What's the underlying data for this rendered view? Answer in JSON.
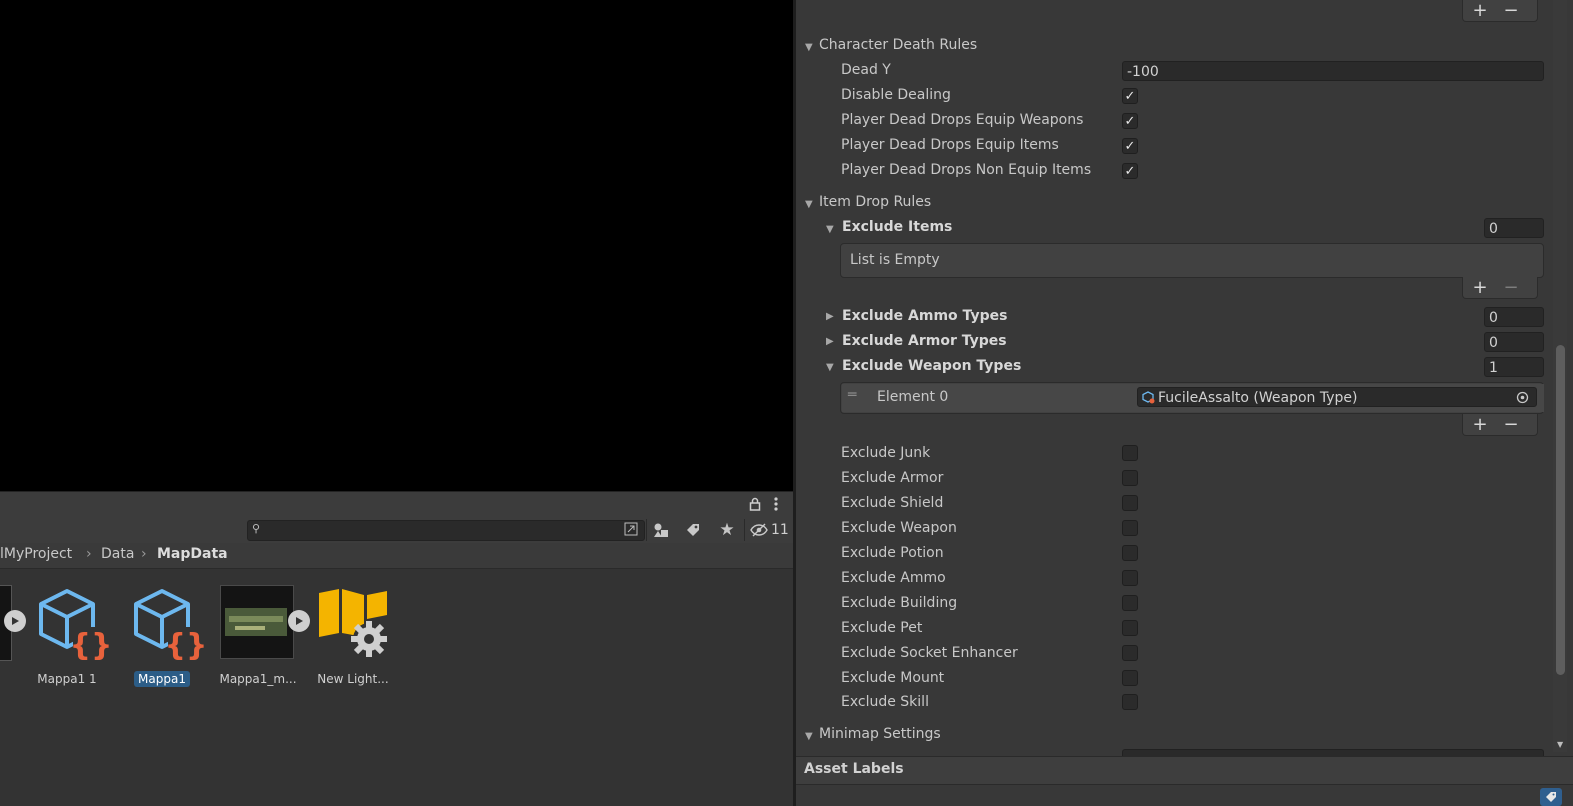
{
  "project": {
    "breadcrumb": [
      "lMyProject",
      "Data",
      "MapData"
    ],
    "hidden_count": "11",
    "assets": [
      {
        "label": "...",
        "icon": "video-asset-icon",
        "selected": false
      },
      {
        "label": "Mappa1 1",
        "icon": "scriptable-object-icon",
        "selected": false
      },
      {
        "label": "Mappa1",
        "icon": "scriptable-object-icon",
        "selected": true
      },
      {
        "label": "Mappa1_m...",
        "icon": "texture-thumbnail-icon",
        "selected": false
      },
      {
        "label": "New Light...",
        "icon": "lighting-settings-icon",
        "selected": false
      }
    ]
  },
  "inspector": {
    "character_death": {
      "title": "Character Death Rules",
      "dead_y_label": "Dead Y",
      "dead_y_value": "-100",
      "checks": [
        {
          "label": "Disable Dealing",
          "checked": true
        },
        {
          "label": "Player Dead Drops Equip Weapons",
          "checked": true
        },
        {
          "label": "Player Dead Drops Equip Items",
          "checked": true
        },
        {
          "label": "Player Dead Drops Non Equip Items",
          "checked": true
        }
      ]
    },
    "item_drop": {
      "title": "Item Drop Rules",
      "exclude_items": {
        "label": "Exclude Items",
        "count": "0",
        "empty_text": "List is Empty"
      },
      "exclude_ammo": {
        "label": "Exclude Ammo Types",
        "count": "0"
      },
      "exclude_armor": {
        "label": "Exclude Armor Types",
        "count": "0"
      },
      "exclude_weapon": {
        "label": "Exclude Weapon Types",
        "count": "1",
        "element_label": "Element 0",
        "element_value": "FucileAssalto (Weapon Type)"
      },
      "checks": [
        {
          "label": "Exclude Junk",
          "checked": false
        },
        {
          "label": "Exclude Armor",
          "checked": false
        },
        {
          "label": "Exclude Shield",
          "checked": false
        },
        {
          "label": "Exclude Weapon",
          "checked": false
        },
        {
          "label": "Exclude Potion",
          "checked": false
        },
        {
          "label": "Exclude Ammo",
          "checked": false
        },
        {
          "label": "Exclude Building",
          "checked": false
        },
        {
          "label": "Exclude Pet",
          "checked": false
        },
        {
          "label": "Exclude Socket Enhancer",
          "checked": false
        },
        {
          "label": "Exclude Mount",
          "checked": false
        },
        {
          "label": "Exclude Skill",
          "checked": false
        }
      ]
    },
    "minimap": {
      "title": "Minimap Settings"
    },
    "asset_labels": "Asset Labels",
    "plus": "+",
    "minus": "−",
    "checkmark": "✓"
  }
}
